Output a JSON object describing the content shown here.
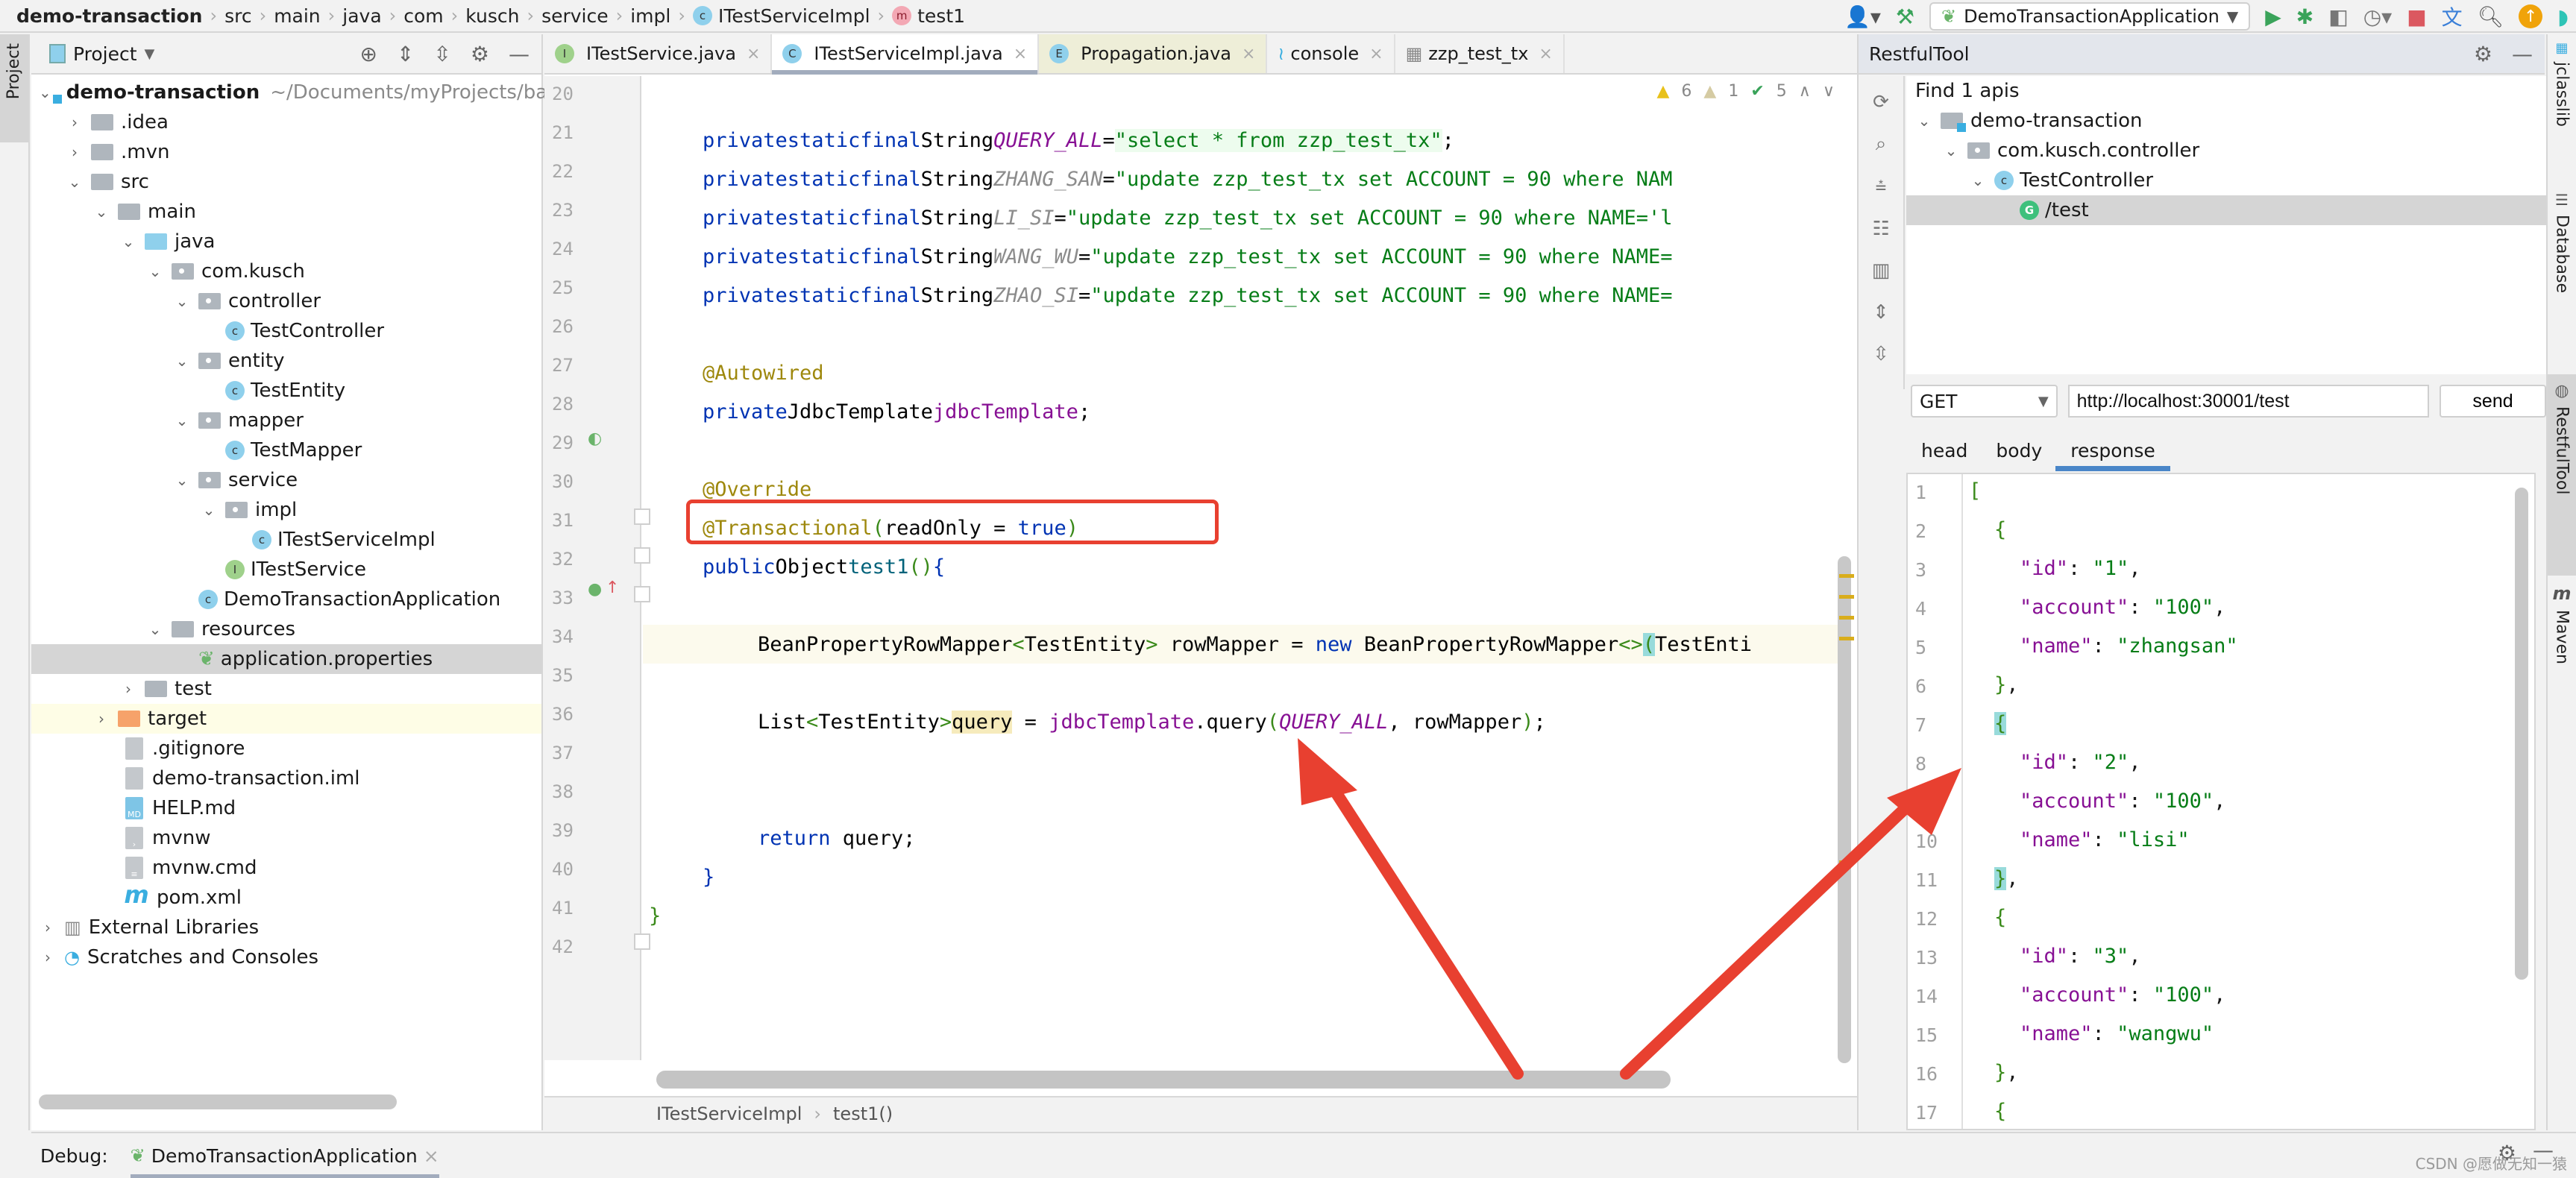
{
  "navbar": {
    "crumbs": [
      "demo-transaction",
      "src",
      "main",
      "java",
      "com",
      "kusch",
      "service",
      "impl",
      "ITestServiceImpl",
      "test1"
    ],
    "run_config": "DemoTransactionApplication"
  },
  "left_strip": {
    "project_tab": "Project"
  },
  "project_panel": {
    "title": "Project",
    "tree": [
      {
        "label": "demo-transaction",
        "path": "~/Documents/myProjects/ba"
      },
      {
        "label": ".idea"
      },
      {
        "label": ".mvn"
      },
      {
        "label": "src"
      },
      {
        "label": "main"
      },
      {
        "label": "java"
      },
      {
        "label": "com.kusch"
      },
      {
        "label": "controller"
      },
      {
        "label": "TestController"
      },
      {
        "label": "entity"
      },
      {
        "label": "TestEntity"
      },
      {
        "label": "mapper"
      },
      {
        "label": "TestMapper"
      },
      {
        "label": "service"
      },
      {
        "label": "impl"
      },
      {
        "label": "ITestServiceImpl"
      },
      {
        "label": "ITestService"
      },
      {
        "label": "DemoTransactionApplication"
      },
      {
        "label": "resources"
      },
      {
        "label": "application.properties"
      },
      {
        "label": "test"
      },
      {
        "label": "target"
      },
      {
        "label": ".gitignore"
      },
      {
        "label": "demo-transaction.iml"
      },
      {
        "label": "HELP.md"
      },
      {
        "label": "mvnw"
      },
      {
        "label": "mvnw.cmd"
      },
      {
        "label": "pom.xml"
      },
      {
        "label": "External Libraries"
      },
      {
        "label": "Scratches and Consoles"
      }
    ]
  },
  "editor": {
    "tabs": [
      {
        "label": "ITestService.java",
        "badge": "I"
      },
      {
        "label": "ITestServiceImpl.java",
        "badge": "C"
      },
      {
        "label": "Propagation.java",
        "badge": "E"
      },
      {
        "label": "console"
      },
      {
        "label": "zzp_test_tx"
      }
    ],
    "inspections": {
      "warnings": "6",
      "weak_warnings": "1",
      "ok": "5"
    },
    "line_numbers": [
      "20",
      "21",
      "22",
      "23",
      "24",
      "25",
      "26",
      "27",
      "28",
      "29",
      "30",
      "31",
      "32",
      "33",
      "34",
      "35",
      "36",
      "37",
      "38",
      "39",
      "40",
      "41",
      "42"
    ],
    "code": {
      "l21_name": "QUERY_ALL",
      "l21_str": "\"select * from zzp_test_tx\"",
      "l22_name": "ZHANG_SAN",
      "l22_str": "\"update zzp_test_tx set ACCOUNT = 90 where NAM",
      "l23_name": "LI_SI",
      "l23_str": "\"update zzp_test_tx set ACCOUNT = 90 where NAME='l",
      "l24_name": "WANG_WU",
      "l24_str": "\"update zzp_test_tx set ACCOUNT = 90 where NAME=",
      "l25_name": "ZHAO_SI",
      "l25_str": "\"update zzp_test_tx set ACCOUNT = 90 where NAME=",
      "kw_private": "private",
      "kw_static": "static",
      "kw_final": "final",
      "ty_string": "String",
      "l27": "@Autowired",
      "l28_type": "JdbcTemplate",
      "l28_field": "jdbcTemplate",
      "l30": "@Override",
      "l31_ann": "@Transactional",
      "l31_param": "readOnly",
      "l31_val": "true",
      "l32_kw": "public",
      "l32_type": "Object",
      "l32_method": "test1",
      "l34_a": "BeanPropertyRowMapper",
      "l34_b": "TestEntity",
      "l34_c": " rowMapper = ",
      "l34_new": "new",
      "l34_d": " BeanPropertyRowMapper",
      "l34_e": "TestEnti",
      "l36_a": "List",
      "l36_b": "TestEntity",
      "l36_var": "query",
      "l36_field": "jdbcTemplate",
      "l36_call": ".query",
      "l36_arg1": "QUERY_ALL",
      "l36_arg2": ", rowMapper",
      "l39_kw": "return",
      "l39_rest": " query;"
    },
    "breadcrumb": [
      "ITestServiceImpl",
      "test1()"
    ]
  },
  "restful": {
    "title": "RestfulTool",
    "find_text": "Find 1 apis",
    "tree": [
      "demo-transaction",
      "com.kusch.controller",
      "TestController",
      "/test"
    ],
    "method": "GET",
    "url": "http://localhost:30001/test",
    "send_label": "send",
    "tabs": [
      "head",
      "body",
      "response"
    ],
    "active_tab": "response",
    "response_lines": [
      "1",
      "2",
      "3",
      "4",
      "5",
      "6",
      "7",
      "8",
      "9",
      "10",
      "11",
      "12",
      "13",
      "14",
      "15",
      "16",
      "17"
    ],
    "response": [
      {
        "id": "1",
        "account": "100",
        "name": "zhangsan"
      },
      {
        "id": "2",
        "account": "100",
        "name": "lisi"
      },
      {
        "id": "3",
        "account": "100",
        "name": "wangwu"
      }
    ],
    "json_keys": {
      "id": "\"id\"",
      "account": "\"account\"",
      "name": "\"name\""
    }
  },
  "right_strip": [
    "jclasslib",
    "Database",
    "RestfulTool",
    "Maven"
  ],
  "debug": {
    "label": "Debug:",
    "session": "DemoTransactionApplication"
  },
  "watermark": "CSDN @愿做无知一猿",
  "colors": {
    "annotation_red": "#e84030",
    "accent_blue": "#4a86c8"
  }
}
